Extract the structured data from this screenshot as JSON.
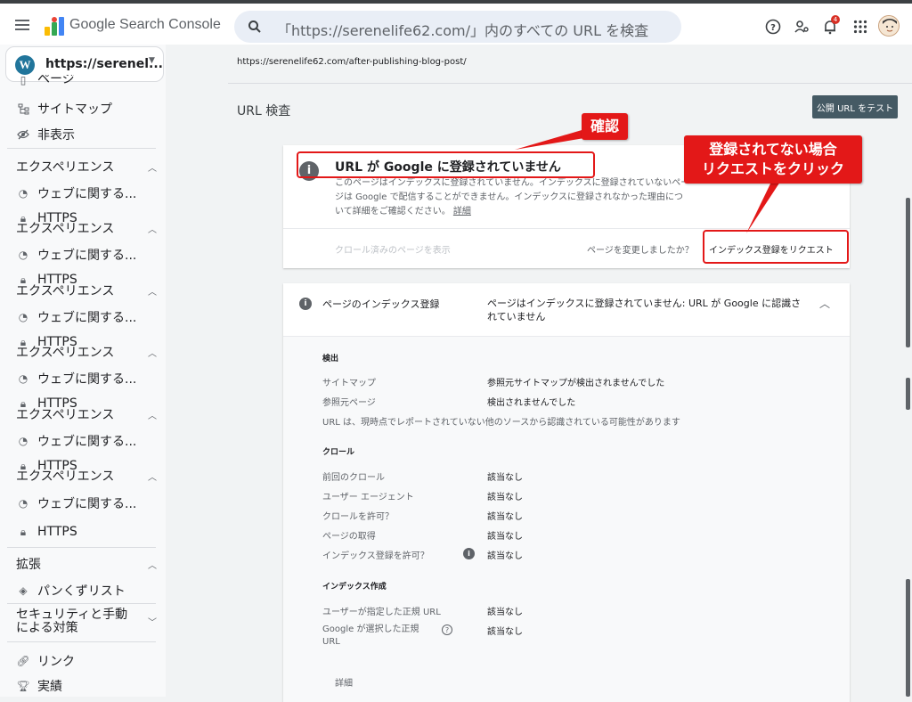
{
  "app": {
    "brand": "Google Search Console",
    "search_placeholder": "「https://serenelife62.com/」内のすべての URL を検査",
    "notification_count": "4"
  },
  "property": {
    "name": "https://serenel..."
  },
  "sidebar": {
    "top_items": [
      {
        "label": "ページ",
        "icon": "pages-icon"
      },
      {
        "label": "サイトマップ",
        "icon": "sitemap-icon"
      },
      {
        "label": "非表示",
        "icon": "eye-off-icon"
      }
    ],
    "experience_section": "エクスペリエンス",
    "experience_item": "ウェブに関する...",
    "https_item": "HTTPS",
    "enhancements_section": "拡張",
    "breadcrumb_item": "パンくずリスト",
    "security_section": "セキュリティと手動\nによる対策",
    "links_item": "リンク",
    "achievements_item": "実績"
  },
  "main": {
    "crumb_url": "https://serenelife62.com/after-publishing-blog-post/",
    "page_title": "URL 検査",
    "test_button": "公開 URL をテスト",
    "status_card": {
      "title": "URL が Google に登録されていません",
      "desc": "このページはインデックスに登録されていません。インデックスに登録されていないページは Google で配信することができません。インデックスに登録されなかった理由について詳細をご確認ください。",
      "detail_link": "詳細",
      "crawled_link": "クロール済みのページを表示",
      "changed_question": "ページを変更しましたか？",
      "request_link": "インデックス登録をリクエスト"
    },
    "index_card": {
      "label": "ページのインデックス登録",
      "status": "ページはインデックスに登録されていません: URL が Google に認識されていません",
      "discovery_heading": "検出",
      "discovery_rows": [
        {
          "key": "サイトマップ",
          "value": "参照元サイトマップが検出されませんでした"
        },
        {
          "key": "参照元ページ",
          "value": "検出されませんでした"
        }
      ],
      "discovery_note": "URL は、現時点でレポートされていない他のソースから認識されている可能性があります",
      "crawl_heading": "クロール",
      "crawl_rows": [
        {
          "key": "前回のクロール",
          "value": "該当なし"
        },
        {
          "key": "ユーザー エージェント",
          "value": "該当なし"
        },
        {
          "key": "クロールを許可？",
          "value": "該当なし"
        },
        {
          "key": "ページの取得",
          "value": "該当なし"
        },
        {
          "key": "インデックス登録を許可？",
          "value": "該当なし"
        }
      ],
      "indexing_heading": "インデックス作成",
      "indexing_rows": [
        {
          "key": "ユーザーが指定した正規 URL",
          "value": "該当なし"
        },
        {
          "key": "Google が選択した正規\nURL",
          "value": "該当なし"
        }
      ],
      "detail_link": "詳細"
    }
  },
  "annotations": {
    "confirm_label": "確認",
    "request_label": "登録されてない場合\nリクエストをクリック",
    "color": "#e31818"
  }
}
